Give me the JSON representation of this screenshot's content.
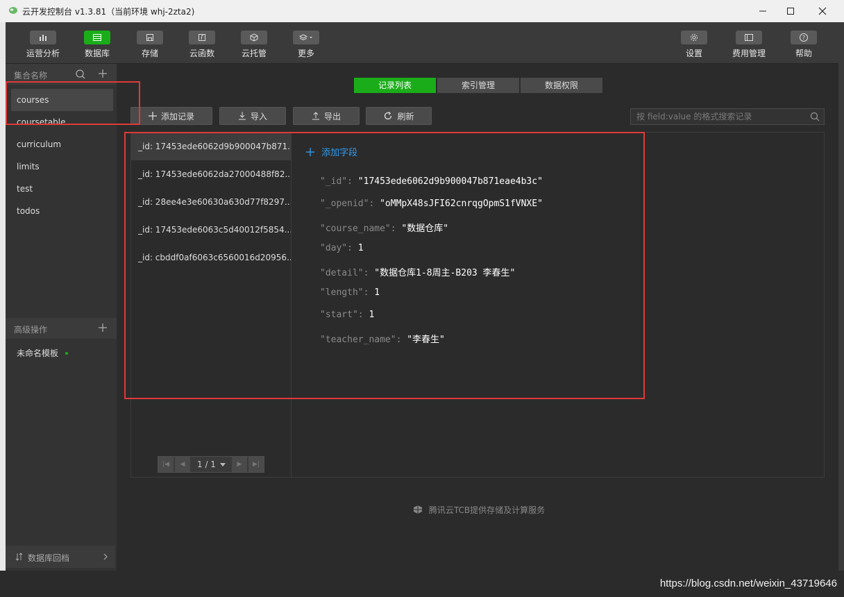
{
  "window": {
    "title": "云开发控制台 v1.3.81（当前环境 whj-2zta2)"
  },
  "toolbar": {
    "left": [
      {
        "label": "运营分析"
      },
      {
        "label": "数据库"
      },
      {
        "label": "存储"
      },
      {
        "label": "云函数"
      },
      {
        "label": "云托管"
      },
      {
        "label": "更多"
      }
    ],
    "right": [
      {
        "label": "设置"
      },
      {
        "label": "费用管理"
      },
      {
        "label": "帮助"
      }
    ]
  },
  "sidebar": {
    "header": "集合名称",
    "collections": [
      "courses",
      "coursetable",
      "curriculum",
      "limits",
      "test",
      "todos"
    ],
    "advanced_header": "高级操作",
    "template": "未命名模板",
    "footer": "数据库回档"
  },
  "tabs": [
    "记录列表",
    "索引管理",
    "数据权限"
  ],
  "actions": {
    "add": "添加记录",
    "import": "导入",
    "export": "导出",
    "refresh": "刷新"
  },
  "search": {
    "placeholder": "按 field:value 的格式搜索记录"
  },
  "records": [
    "_id: 17453ede6062d9b900047b871...",
    "_id: 17453ede6062da27000488f82...",
    "_id: 28ee4e3e60630a630d77f8297...",
    "_id: 17453ede6063c5d40012f5854...",
    "_id: cbddf0af6063c6560016d20956..."
  ],
  "pager": {
    "text": "1 / 1"
  },
  "detail": {
    "add_field": "添加字段",
    "fields": [
      {
        "key": "\"_id\":",
        "value": "\"17453ede6062d9b900047b871eae4b3c\""
      },
      {
        "key": "\"_openid\":",
        "value": "\"oMMpX48sJFI62cnrqgOpmS1fVNXE\""
      },
      {
        "key": "\"course_name\":",
        "value": "\"数据仓库\""
      },
      {
        "key": "\"day\":",
        "value": "1"
      },
      {
        "key": "\"detail\":",
        "value": "\"数据仓库1-8周主-B203 李春生\""
      },
      {
        "key": "\"length\":",
        "value": "1"
      },
      {
        "key": "\"start\":",
        "value": "1"
      },
      {
        "key": "\"teacher_name\":",
        "value": "\"李春生\""
      }
    ]
  },
  "footer": "腾讯云TCB提供存储及计算服务",
  "watermark": "https://blog.csdn.net/weixin_43719646",
  "colors": {
    "accent": "#1aad19",
    "highlight": "#e03a3a",
    "link": "#2f9cf0"
  }
}
